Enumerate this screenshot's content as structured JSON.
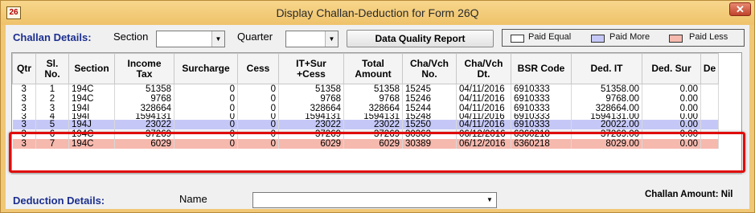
{
  "window": {
    "title": "Display Challan-Deduction for Form 26Q",
    "icon_label": "26",
    "close_symbol": "✕"
  },
  "filters": {
    "challan_details_label": "Challan Details:",
    "section_label": "Section",
    "section_value": "",
    "quarter_label": "Quarter",
    "quarter_value": "",
    "data_quality_button": "Data Quality Report"
  },
  "legend": {
    "paid_equal": "Paid Equal",
    "paid_more": "Paid More",
    "paid_less": "Paid Less",
    "colors": {
      "paid_equal": "#ffffff",
      "paid_more": "#c5c8f7",
      "paid_less": "#f6b9ae"
    }
  },
  "table": {
    "columns": [
      "Qtr",
      "Sl.\nNo.",
      "Section",
      "Income\nTax",
      "Surcharge",
      "Cess",
      "IT+Sur\n+Cess",
      "Total\nAmount",
      "Cha/Vch\nNo.",
      "Cha/Vch\nDt.",
      "BSR Code",
      "Ded. IT",
      "Ded. Sur",
      "De"
    ],
    "rows": [
      {
        "status": "paid-equal",
        "cells": [
          "3",
          "1",
          "194C",
          "51358",
          "0",
          "0",
          "51358",
          "51358",
          "15245",
          "04/11/2016",
          "6910333",
          "51358.00",
          "0.00",
          ""
        ]
      },
      {
        "status": "paid-equal",
        "cells": [
          "3",
          "2",
          "194C",
          "9768",
          "0",
          "0",
          "9768",
          "9768",
          "15246",
          "04/11/2016",
          "6910333",
          "9768.00",
          "0.00",
          ""
        ]
      },
      {
        "status": "paid-equal",
        "cells": [
          "3",
          "3",
          "194I",
          "328664",
          "0",
          "0",
          "328664",
          "328664",
          "15244",
          "04/11/2016",
          "6910333",
          "328664.00",
          "0.00",
          ""
        ]
      },
      {
        "status": "paid-equal",
        "cells": [
          "3",
          "4",
          "194I",
          "1594131",
          "0",
          "0",
          "1594131",
          "1594131",
          "15248",
          "04/11/2016",
          "6910333",
          "1594131.00",
          "0.00",
          ""
        ]
      },
      {
        "status": "paid-more",
        "cells": [
          "3",
          "5",
          "194J",
          "23022",
          "0",
          "0",
          "23022",
          "23022",
          "15250",
          "04/11/2016",
          "6910333",
          "20022.00",
          "0.00",
          ""
        ]
      },
      {
        "status": "paid-equal",
        "cells": [
          "3",
          "6",
          "194C",
          "37269",
          "0",
          "0",
          "37269",
          "37269",
          "30363",
          "06/12/2016",
          "6360218",
          "37269.00",
          "0.00",
          ""
        ]
      },
      {
        "status": "paid-less",
        "cells": [
          "3",
          "7",
          "194C",
          "6029",
          "0",
          "0",
          "6029",
          "6029",
          "30389",
          "06/12/2016",
          "6360218",
          "8029.00",
          "0.00",
          ""
        ]
      }
    ]
  },
  "deduction": {
    "label": "Deduction Details:",
    "name_label": "Name",
    "name_value": "",
    "challan_amount": "Challan Amount: Nil"
  }
}
